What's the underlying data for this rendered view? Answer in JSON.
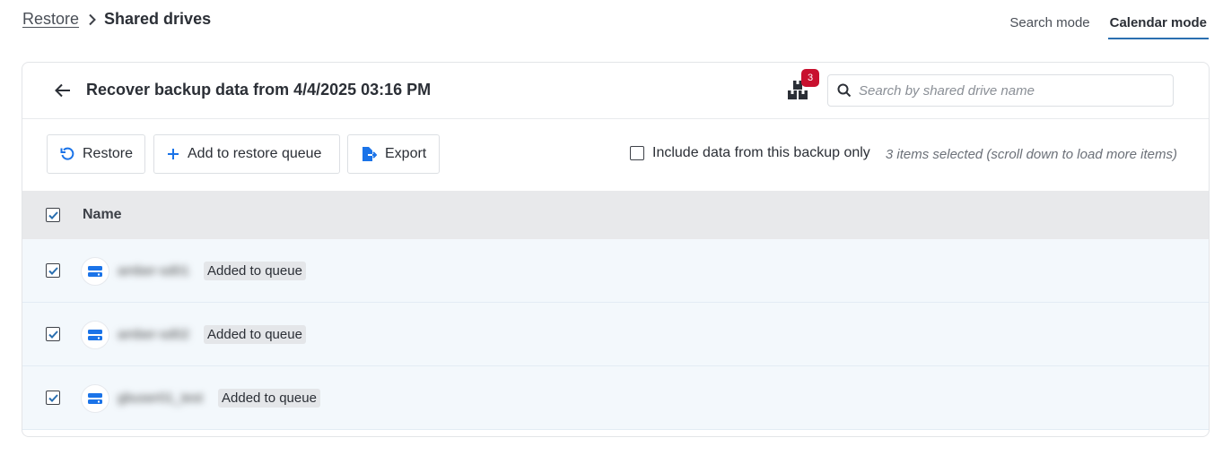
{
  "breadcrumb": {
    "root": "Restore",
    "current": "Shared drives"
  },
  "modes": {
    "search": "Search mode",
    "calendar": "Calendar mode",
    "active": "calendar"
  },
  "panel": {
    "title": "Recover backup data from 4/4/2025 03:16 PM",
    "queue_count": "3",
    "search_placeholder": "Search by shared drive name"
  },
  "toolbar": {
    "restore_label": "Restore",
    "add_queue_label": "Add to restore queue",
    "export_label": "Export",
    "include_label": "Include data from this backup only",
    "selected_note": "3 items selected (scroll down to load more items)"
  },
  "table": {
    "column_name": "Name",
    "rows": [
      {
        "name": "amber-sd01",
        "tag": "Added to queue",
        "checked": true
      },
      {
        "name": "amber-sd02",
        "tag": "Added to queue",
        "checked": true
      },
      {
        "name": "gbuser01_test",
        "tag": "Added to queue",
        "checked": true
      }
    ]
  },
  "colors": {
    "accent": "#2a6fb0",
    "badge": "#c8102e",
    "drive_icon": "#1a73e8",
    "row_bg": "#f3f8fc"
  }
}
